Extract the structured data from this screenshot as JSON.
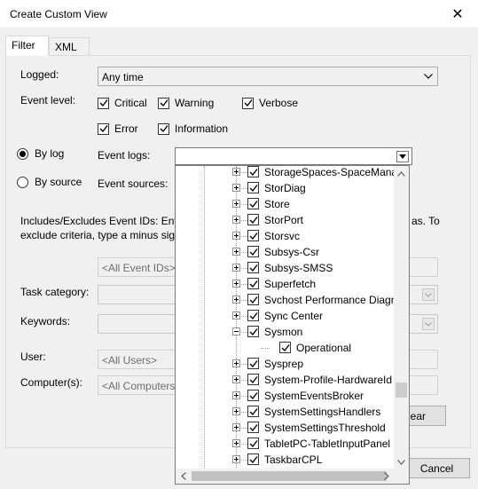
{
  "window": {
    "title": "Create Custom View"
  },
  "tabs": [
    {
      "label": "Filter"
    },
    {
      "label": "XML"
    }
  ],
  "filter": {
    "logged_label": "Logged:",
    "logged_value": "Any time",
    "event_level_label": "Event level:",
    "levels": {
      "critical": "Critical",
      "warning": "Warning",
      "verbose": "Verbose",
      "error": "Error",
      "information": "Information"
    },
    "by_log": "By log",
    "by_source": "By source",
    "event_logs_label": "Event logs:",
    "event_sources_label": "Event sources:",
    "desc_line1": "Includes/Excludes Event IDs: Ente",
    "desc_line1_end": "as. To",
    "desc_line2": "exclude criteria, type a minus sign",
    "event_ids_placeholder": "<All Event IDs>",
    "task_category_label": "Task category:",
    "keywords_label": "Keywords:",
    "user_label": "User:",
    "user_value": "<All Users>",
    "computer_label": "Computer(s):",
    "computer_value": "<All Computers",
    "clear_label": "lear",
    "cancel_label": "Cancel"
  },
  "tree_items": [
    {
      "label": "StorageSpaces-SpaceManag",
      "checked": true,
      "expander": true,
      "level": 0
    },
    {
      "label": "StorDiag",
      "checked": true,
      "expander": true,
      "level": 0
    },
    {
      "label": "Store",
      "checked": true,
      "expander": true,
      "level": 0
    },
    {
      "label": "StorPort",
      "checked": true,
      "expander": true,
      "level": 0
    },
    {
      "label": "Storsvc",
      "checked": true,
      "expander": true,
      "level": 0
    },
    {
      "label": "Subsys-Csr",
      "checked": true,
      "expander": true,
      "level": 0
    },
    {
      "label": "Subsys-SMSS",
      "checked": true,
      "expander": true,
      "level": 0
    },
    {
      "label": "Superfetch",
      "checked": true,
      "expander": true,
      "level": 0
    },
    {
      "label": "Svchost Performance Diagn",
      "checked": true,
      "expander": true,
      "level": 0
    },
    {
      "label": "Sync Center",
      "checked": true,
      "expander": true,
      "level": 0
    },
    {
      "label": "Sysmon",
      "checked": true,
      "expander": "expanded",
      "level": 0
    },
    {
      "label": "Operational",
      "checked": true,
      "expander": false,
      "level": 1
    },
    {
      "label": "Sysprep",
      "checked": true,
      "expander": true,
      "level": 0
    },
    {
      "label": "System-Profile-HardwareId",
      "checked": true,
      "expander": true,
      "level": 0
    },
    {
      "label": "SystemEventsBroker",
      "checked": true,
      "expander": true,
      "level": 0
    },
    {
      "label": "SystemSettingsHandlers",
      "checked": true,
      "expander": true,
      "level": 0
    },
    {
      "label": "SystemSettingsThreshold",
      "checked": true,
      "expander": true,
      "level": 0
    },
    {
      "label": "TabletPC-TabletInputPanel",
      "checked": true,
      "expander": true,
      "level": 0
    },
    {
      "label": "TaskbarCPL",
      "checked": true,
      "expander": true,
      "level": 0
    }
  ],
  "colors": {
    "check": "#000000",
    "accent_border": "#7a7a7a"
  }
}
